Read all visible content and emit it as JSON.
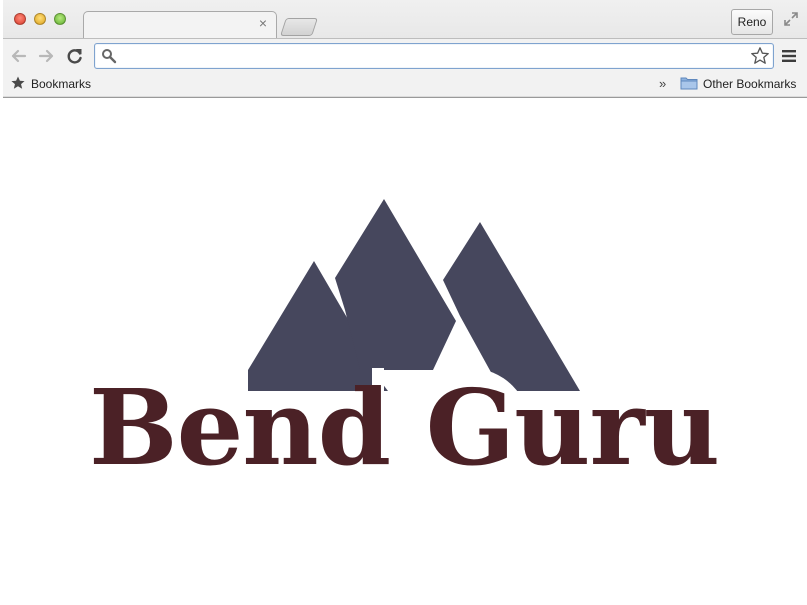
{
  "browser": {
    "profile_name": "Reno",
    "tab_close_symbol": "×",
    "omnibox": {
      "value": "",
      "placeholder": ""
    },
    "bookmarks_bar": {
      "bookmarks_label": "Bookmarks",
      "overflow_symbol": "»",
      "other_bookmarks_label": "Other Bookmarks"
    },
    "icons": {
      "back": "arrow-left-icon",
      "forward": "arrow-right-icon",
      "reload": "reload-icon",
      "search": "search-icon",
      "star": "star-outline-icon",
      "menu": "hamburger-menu-icon",
      "bookmarks": "star-filled-icon",
      "folder": "folder-icon",
      "fullscreen": "fullscreen-icon"
    }
  },
  "page": {
    "logo_text": "Bend Guru",
    "colors": {
      "mountains": "#46475d",
      "logo_text": "#4b2126",
      "omnibox_border": "#7fa3cf",
      "folder": "#7ea6d8"
    }
  }
}
